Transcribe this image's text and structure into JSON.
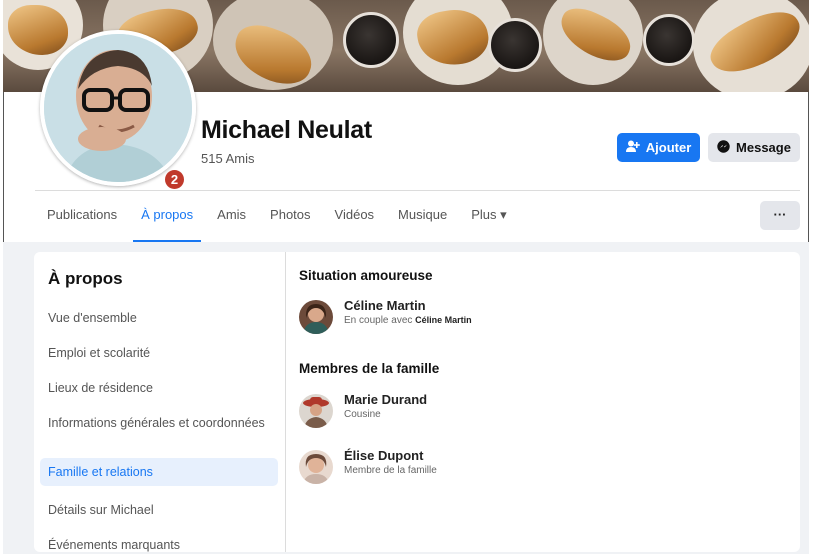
{
  "profile": {
    "name": "Michael Neulat",
    "friends": "515 Amis",
    "step_badge": "2"
  },
  "actions": {
    "add_label": "Ajouter",
    "message_label": "Message",
    "more_label": "···"
  },
  "tabs": [
    {
      "label": "Publications"
    },
    {
      "label": "À propos",
      "active": true
    },
    {
      "label": "Amis"
    },
    {
      "label": "Photos"
    },
    {
      "label": "Vidéos"
    },
    {
      "label": "Musique"
    },
    {
      "label": "Plus ▾"
    }
  ],
  "about": {
    "title": "À propos",
    "items": [
      {
        "label": "Vue d'ensemble"
      },
      {
        "label": "Emploi et scolarité"
      },
      {
        "label": "Lieux de résidence"
      },
      {
        "label": "Informations générales et coordonnées"
      },
      {
        "label": "Famille et relations",
        "active": true
      },
      {
        "label": "Détails sur Michael"
      },
      {
        "label": "Événements marquants"
      }
    ]
  },
  "relationship": {
    "title": "Situation amoureuse",
    "name": "Céline Martin",
    "status_prefix": "En couple avec",
    "partner": "Céline Martin"
  },
  "family": {
    "title": "Membres de la famille",
    "members": [
      {
        "name": "Marie Durand",
        "relation": "Cousine"
      },
      {
        "name": "Élise Dupont",
        "relation": "Membre de la famille"
      }
    ]
  },
  "colors": {
    "accent": "#1877f2",
    "badge": "#c0392b"
  }
}
